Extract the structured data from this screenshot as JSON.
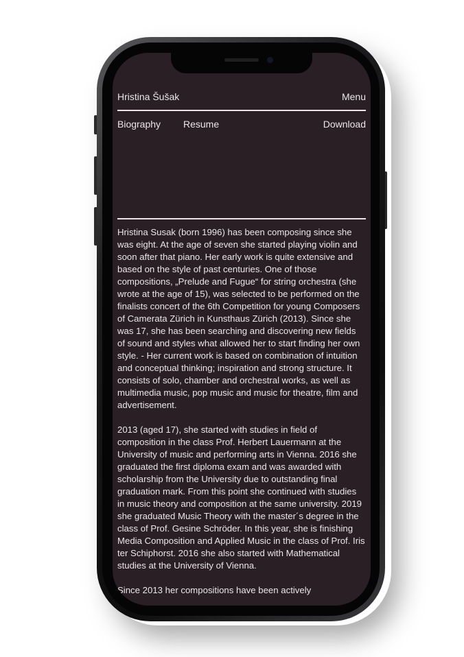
{
  "header": {
    "site_title": "Hristina Šušak",
    "menu_label": "Menu"
  },
  "nav": {
    "biography": "Biography",
    "resume": "Resume",
    "download": "Download"
  },
  "bio": {
    "p1": "Hristina Susak (born 1996) has been composing since she was eight. At the age of seven she started playing violin and soon after that piano. Her early work is quite extensive and based on the style of past centuries. One of those compositions, „Prelude and Fugue“ for string orchestra (she wrote at the age of 15), was selected to be performed on the finalists concert of the 6th Competition for young Composers of Camerata Zürich in Kunsthaus Zürich (2013). Since she was 17, she has been searching and discovering new fields of sound and styles what allowed her to start finding her own style. - Her current work is based on combination of intuition and conceptual thinking; inspiration and strong structure. It consists of solo, chamber and orchestral works, as well as multimedia music, pop music and music for theatre, film and advertisement.",
    "p2": "2013 (aged 17), she started with studies in field of composition in the class Prof. Herbert Lauermann at the University of music and performing arts in Vienna. 2016 she graduated the first diploma exam and was awarded with scholarship from the University due to outstanding final graduation mark. From this point she continued with studies in music theory and composition at the same university. 2019 she graduated Music Theory with the master´s degree in the class of Prof. Gesine Schröder. In this year, she is finishing Media Composition and Applied Music in the class of Prof. Iris ter Schiphorst. 2016 she also started with Mathematical studies at the University of Vienna.",
    "p3": "Since 2013 her compositions have been actively"
  },
  "colors": {
    "screen_bg": "#2a1f24",
    "text": "#eae6e8",
    "phone_frame": "#0d0d0e"
  }
}
